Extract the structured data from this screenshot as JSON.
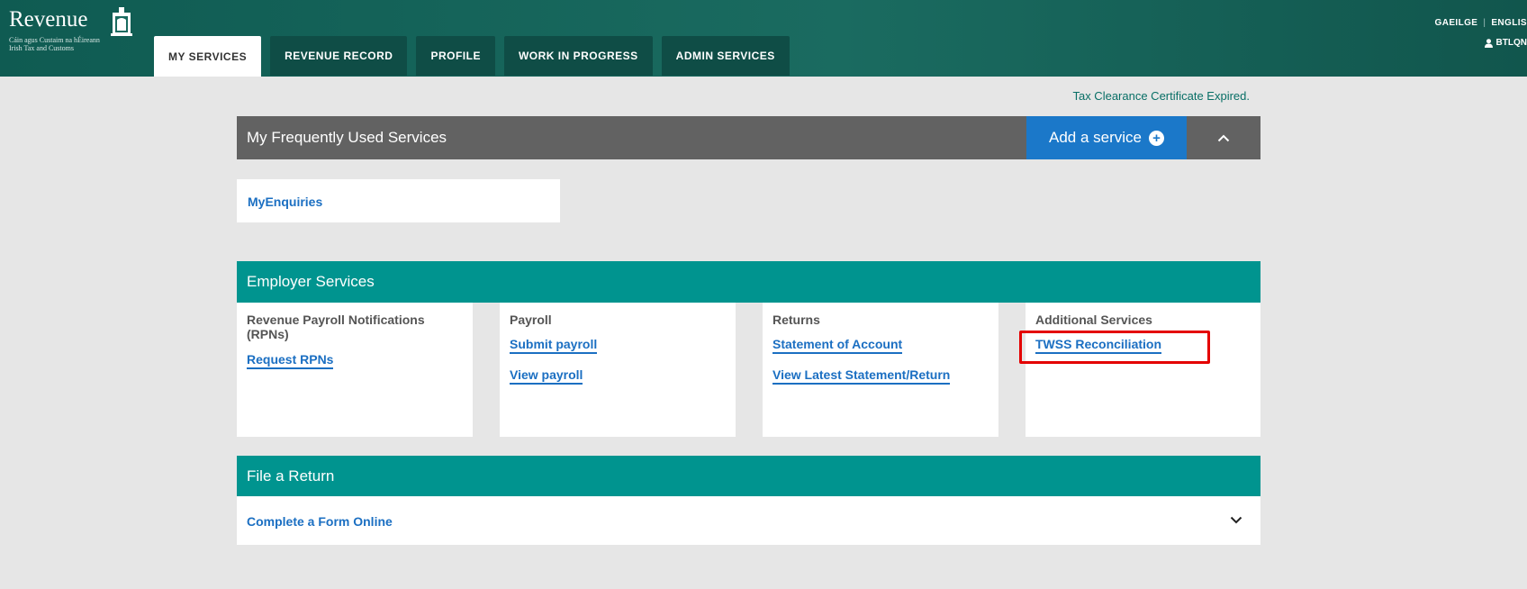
{
  "header": {
    "logo": {
      "word": "Revenue",
      "line1": "Cáin agus Custaim na hÉireann",
      "line2": "Irish Tax and Customs"
    },
    "tabs": [
      {
        "label": "MY SERVICES",
        "active": true
      },
      {
        "label": "REVENUE RECORD",
        "active": false
      },
      {
        "label": "PROFILE",
        "active": false
      },
      {
        "label": "WORK IN PROGRESS",
        "active": false
      },
      {
        "label": "ADMIN SERVICES",
        "active": false
      }
    ],
    "lang": {
      "gaeilge": "GAEILGE",
      "english": "ENGLIS"
    },
    "user": {
      "label": "BTLQN",
      "icon": "user-icon"
    }
  },
  "notice": "Tax Clearance Certificate Expired.",
  "frequent": {
    "title": "My Frequently Used Services",
    "add_label": "Add a service",
    "add_icon": "plus-circle-icon",
    "collapse_icon": "chevron-up-icon",
    "items": [
      "MyEnquiries"
    ]
  },
  "employer": {
    "title": "Employer Services",
    "cards": [
      {
        "heading": "Revenue Payroll Notifications (RPNs)",
        "links": [
          "Request RPNs"
        ]
      },
      {
        "heading": "Payroll",
        "links": [
          "Submit payroll",
          "View payroll"
        ]
      },
      {
        "heading": "Returns",
        "links": [
          "Statement of Account",
          "View Latest Statement/Return"
        ]
      },
      {
        "heading": "Additional Services",
        "links": [
          "TWSS Reconciliation"
        ]
      }
    ]
  },
  "file_return": {
    "title": "File a Return",
    "item": "Complete a Form Online",
    "expand_icon": "chevron-down-icon"
  },
  "colors": {
    "header": "#1a6b60",
    "teal_bar": "#00948f",
    "grey_bar": "#626262",
    "accent_blue": "#1b78c9",
    "link": "#1b6fc2",
    "highlight": "#e40000"
  }
}
